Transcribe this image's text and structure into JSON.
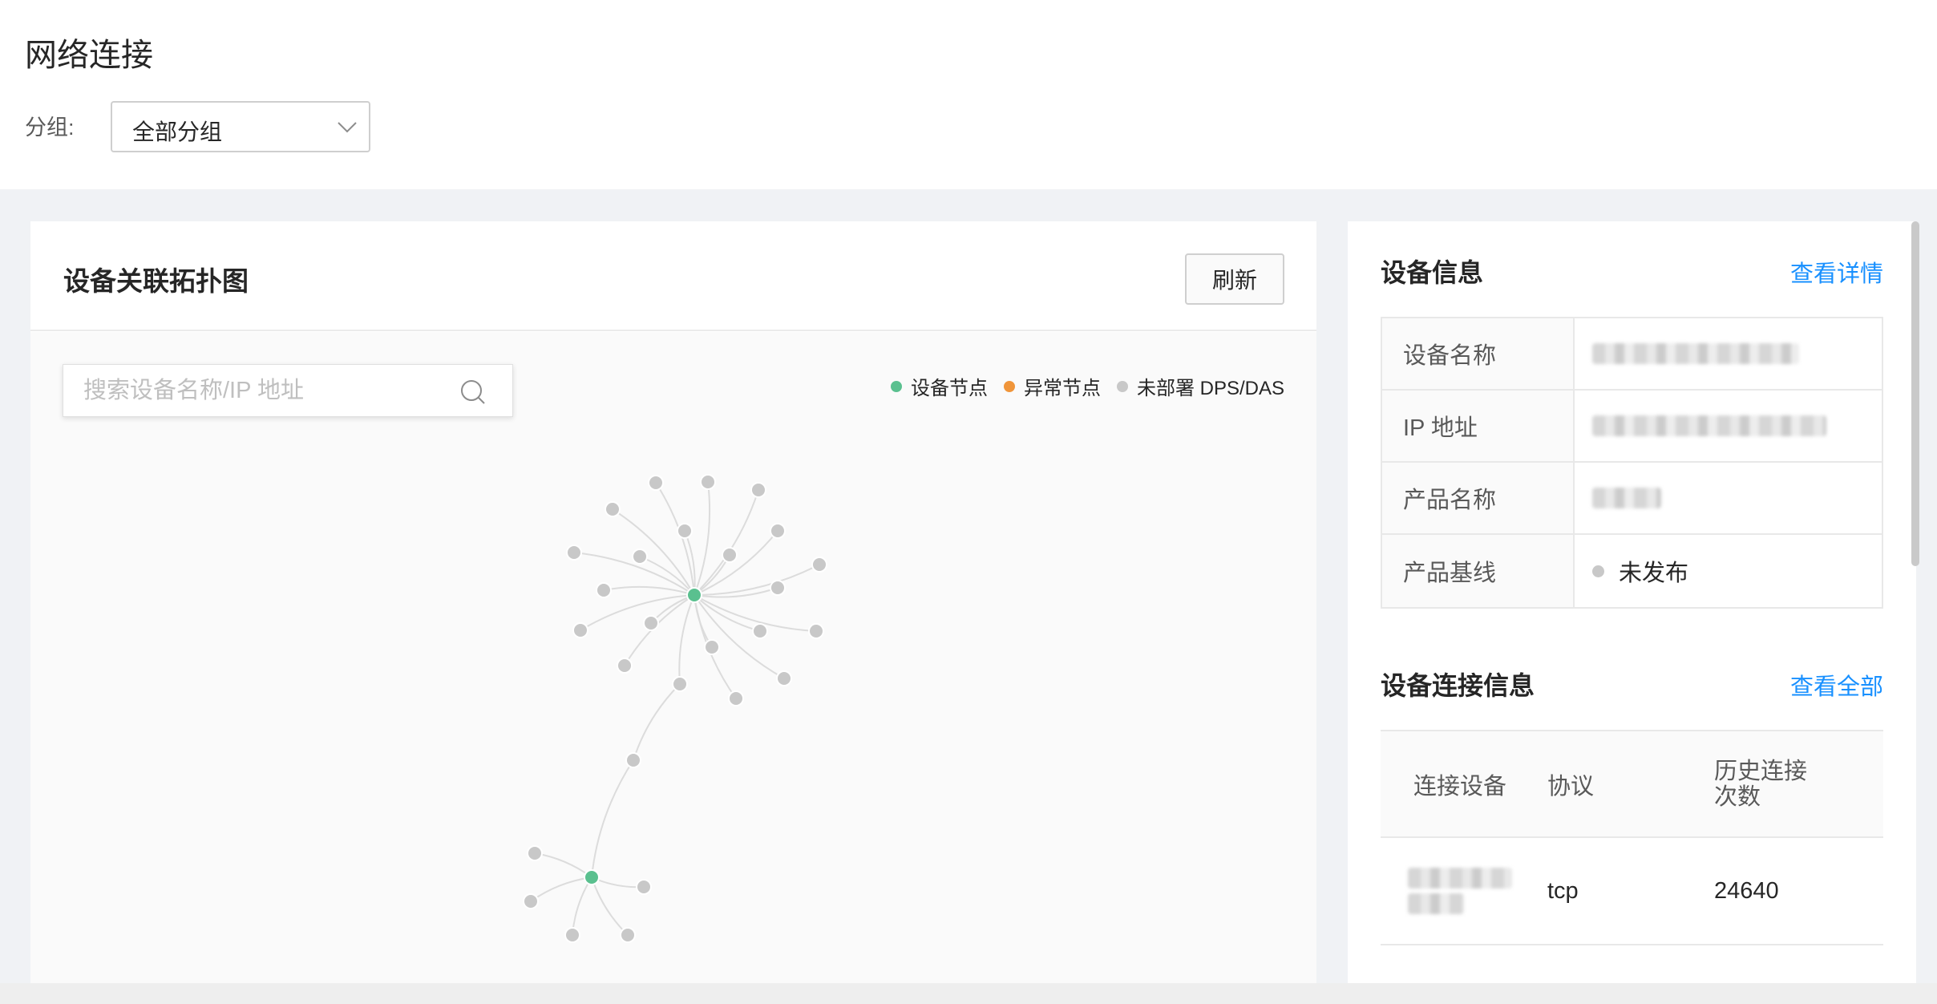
{
  "page": {
    "title": "网络连接",
    "group_label": "分组:",
    "group_select": {
      "value": "全部分组"
    }
  },
  "topology": {
    "title": "设备关联拓扑图",
    "refresh_label": "刷新",
    "search_placeholder": "搜索设备名称/IP 地址",
    "legend": [
      {
        "label": "设备节点",
        "color": "#5ac08f"
      },
      {
        "label": "异常节点",
        "color": "#f0953a"
      },
      {
        "label": "未部署 DPS/DAS",
        "color": "#c8c8c8"
      }
    ],
    "colors": {
      "device": "#5ac08f",
      "abnormal": "#f0953a",
      "undeployed": "#c8c8c8",
      "edge": "#dcdcdc"
    }
  },
  "device_info": {
    "title": "设备信息",
    "link": "查看详情",
    "rows": [
      {
        "key": "设备名称",
        "value": ""
      },
      {
        "key": "IP 地址",
        "value": ""
      },
      {
        "key": "产品名称",
        "value": ""
      },
      {
        "key": "产品基线",
        "value": "未发布"
      }
    ]
  },
  "connections": {
    "title": "设备连接信息",
    "link": "查看全部",
    "columns": [
      "连接设备",
      "协议",
      "历史连接次数"
    ],
    "rows": [
      {
        "device": "",
        "protocol": "tcp",
        "count": "24640"
      }
    ]
  }
}
